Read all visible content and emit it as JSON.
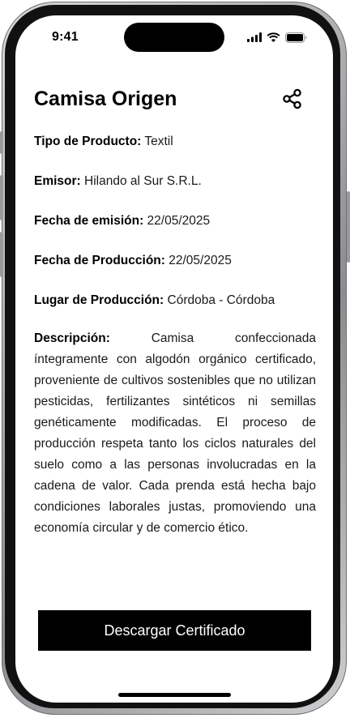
{
  "status_bar": {
    "time": "9:41",
    "icons": [
      "signal-icon",
      "wifi-icon",
      "battery-icon"
    ]
  },
  "header": {
    "title": "Camisa Origen",
    "share_icon": "share-icon"
  },
  "fields": {
    "tipo": {
      "label": "Tipo de Producto:",
      "value": "Textil"
    },
    "emisor": {
      "label": "Emisor:",
      "value": "Hilando al Sur S.R.L."
    },
    "fecha_emision": {
      "label": "Fecha de emisión:",
      "value": "22/05/2025"
    },
    "fecha_produccion": {
      "label": "Fecha de Producción:",
      "value": "22/05/2025"
    },
    "lugar": {
      "label": "Lugar de Producción:",
      "value": "Córdoba - Córdoba"
    },
    "descripcion": {
      "label": "Descripción:",
      "value": "Camisa confeccionada íntegramente con algodón orgánico certificado, proveniente de cultivos sostenibles que no utilizan pesticidas, fertilizantes sintéticos ni semillas genéticamente modificadas. El proceso de producción respeta tanto los ciclos naturales del suelo como a las personas involucradas en la cadena de valor. Cada prenda está hecha bajo condiciones laborales justas, promoviendo una economía circular y de comercio ético."
    }
  },
  "actions": {
    "download_label": "Descargar Certificado"
  },
  "colors": {
    "primary": "#000000",
    "background": "#ffffff",
    "text": "#1a1a1a"
  }
}
